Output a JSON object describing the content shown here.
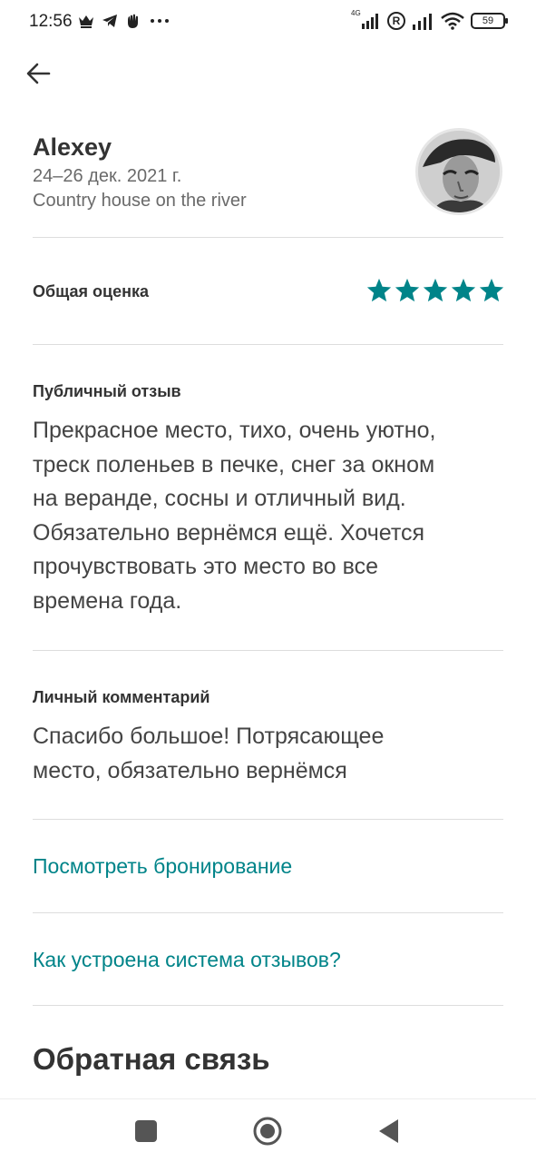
{
  "status_bar": {
    "time": "12:56",
    "left_icons": [
      "crown-icon",
      "telegram-icon",
      "hand-icon",
      "more-dots-icon"
    ],
    "network_label": "4G",
    "registered_label": "R",
    "battery_level": "59"
  },
  "header": {
    "host_name": "Alexey",
    "dates": "24–26 дек. 2021 г.",
    "listing": "Country house on the river"
  },
  "rating": {
    "label": "Общая оценка",
    "value": 5,
    "max": 5,
    "color": "#008489"
  },
  "public_review": {
    "label": "Публичный отзыв",
    "lines": [
      "Прекрасное место, тихо, очень уютно,",
      "треск поленьев в печке, снег за окном",
      "на веранде, сосны и отличный вид.",
      "Обязательно вернёмся ещё. Хочется",
      "прочувствовать это место во все",
      "времена года."
    ]
  },
  "private_comment": {
    "label": "Личный комментарий",
    "lines": [
      "Спасибо большое! Потрясающее",
      "место, обязательно вернёмся"
    ]
  },
  "links": {
    "view_booking": "Посмотреть бронирование",
    "how_reviews_work": "Как устроена система отзывов?"
  },
  "feedback": {
    "title": "Обратная связь"
  },
  "nav": {
    "buttons": [
      "recent-apps-icon",
      "home-icon",
      "back-icon"
    ]
  },
  "colors": {
    "accent": "#008489",
    "text_primary": "#333333",
    "text_secondary": "#6a6a6a"
  }
}
